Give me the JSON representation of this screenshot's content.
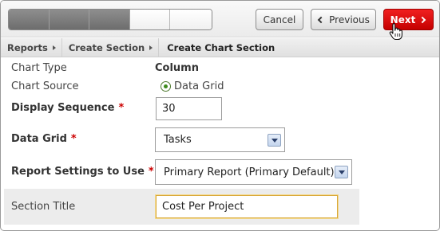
{
  "toolbar": {
    "progress_steps": [
      {
        "state": "done"
      },
      {
        "state": "done"
      },
      {
        "state": "done"
      },
      {
        "state": "todo"
      },
      {
        "state": "todo"
      }
    ],
    "cancel_label": "Cancel",
    "previous_label": "Previous",
    "next_label": "Next",
    "next_color": "#d80000"
  },
  "breadcrumb": {
    "items": [
      "Reports",
      "Create Section"
    ],
    "current": "Create Chart Section"
  },
  "form": {
    "chart_type": {
      "label": "Chart Type",
      "value": "Column"
    },
    "chart_source": {
      "label": "Chart Source",
      "option": "Data Grid",
      "selected": true
    },
    "display_sequence": {
      "label": "Display Sequence",
      "required_mark": "*",
      "value": "30"
    },
    "data_grid": {
      "label": "Data Grid",
      "required_mark": "*",
      "selected": "Tasks"
    },
    "report_settings": {
      "label": "Report Settings to Use",
      "required_mark": "*",
      "selected": "Primary Report (Primary Default)"
    },
    "section_title": {
      "label": "Section Title",
      "value": "Cost Per Project"
    }
  },
  "icons": {
    "cursor": "hand-pointer-icon",
    "previous": "chevron-left-icon",
    "next": "chevron-right-icon",
    "dropdown": "chevron-down-icon"
  }
}
